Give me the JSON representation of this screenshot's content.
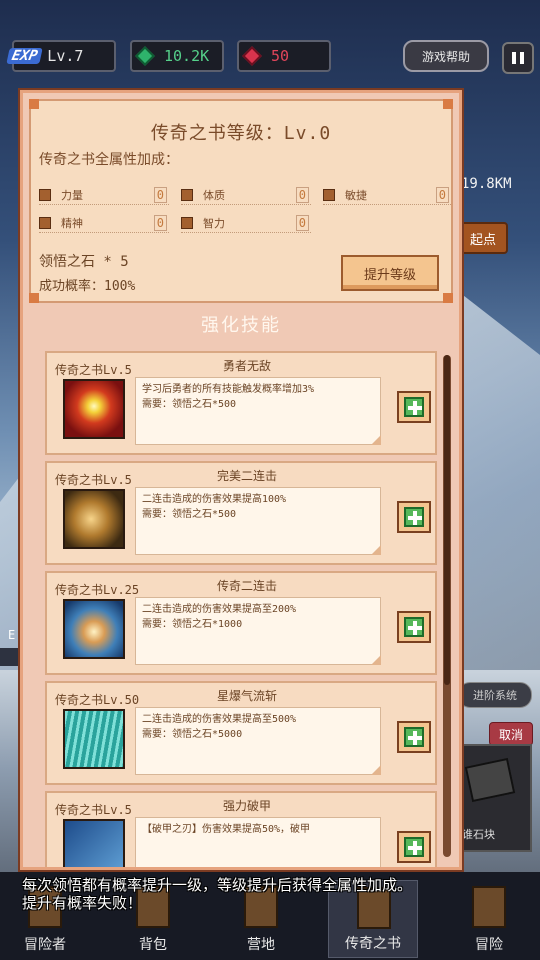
{
  "hud": {
    "exp_tag": "EXP",
    "level": "Lv.7",
    "gems": "10.2K",
    "rubies": "50",
    "help": "游戏帮助"
  },
  "background": {
    "distance": "19.8KM",
    "start": "起点",
    "system": "进阶系统",
    "cancel": "取消",
    "stone_label": "谁石块",
    "left_e": "E"
  },
  "panel": {
    "title": "传奇之书等级：Lv.0",
    "bonus_label": "传奇之书全属性加成：",
    "attrs": [
      {
        "label": "力量",
        "value": "0"
      },
      {
        "label": "体质",
        "value": "0"
      },
      {
        "label": "敏捷",
        "value": "0"
      },
      {
        "label": "精神",
        "value": "0"
      },
      {
        "label": "智力",
        "value": "0"
      }
    ],
    "stone": "领悟之石 * 5",
    "rate": "成功概率：100%",
    "upgrade": "提升等级",
    "section": "强化技能"
  },
  "skills": [
    {
      "level": "传奇之书Lv.5",
      "name": "勇者无敌",
      "desc": "学习后勇者的所有技能触发概率增加3%",
      "req": "需要：领悟之石*500",
      "icon": "star-burst-icon"
    },
    {
      "level": "传奇之书Lv.5",
      "name": "完美二连击",
      "desc": "二连击造成的伤害效果提高100%",
      "req": "需要：领悟之石*500",
      "icon": "glowing-hand-icon"
    },
    {
      "level": "传奇之书Lv.25",
      "name": "传奇二连击",
      "desc": "二连击造成的伤害效果提高至200%",
      "req": "需要：领悟之石*1000",
      "icon": "fist-icon"
    },
    {
      "level": "传奇之书Lv.50",
      "name": "星爆气流斩",
      "desc": "二连击造成的伤害效果提高至500%",
      "req": "需要：领悟之石*5000",
      "icon": "energy-rain-icon"
    },
    {
      "level": "传奇之书Lv.5",
      "name": "强力破甲",
      "desc": "【破甲之刃】伤害效果提高50%，破甲",
      "req": "",
      "icon": "armor-break-icon"
    }
  ],
  "nav": [
    {
      "label": "冒险者"
    },
    {
      "label": "背包"
    },
    {
      "label": "营地"
    },
    {
      "label": "传奇之书"
    },
    {
      "label": "冒险"
    }
  ],
  "tooltip": {
    "line1": "每次领悟都有概率提升一级，等级提升后获得全属性加成。",
    "line2": "提升有概率失败！"
  }
}
